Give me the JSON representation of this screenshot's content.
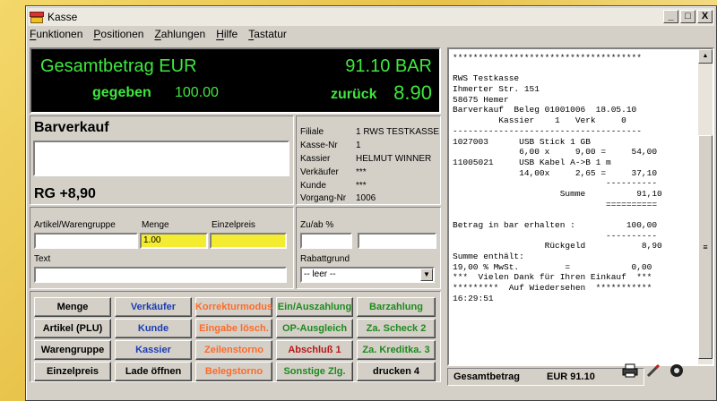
{
  "window": {
    "title": "Kasse",
    "controls": [
      "_",
      "□",
      "X"
    ]
  },
  "menu": [
    "Funktionen",
    "Positionen",
    "Zahlungen",
    "Hilfe",
    "Tastatur"
  ],
  "display": {
    "total_label": "Gesamtbetrag EUR",
    "total_value": "91.10 BAR",
    "given_label": "gegeben",
    "given_value": "100.00",
    "change_label": "zurück",
    "change_value": "8.90"
  },
  "sale": {
    "title": "Barverkauf",
    "rg": "RG +8,90"
  },
  "info": [
    {
      "k": "Filiale",
      "v": "1 RWS TESTKASSE"
    },
    {
      "k": "Kasse-Nr",
      "v": "1"
    },
    {
      "k": "Kassier",
      "v": "HELMUT WINNER"
    },
    {
      "k": "Verkäufer",
      "v": "***"
    },
    {
      "k": "Kunde",
      "v": "***"
    },
    {
      "k": "Vorgang-Nr",
      "v": "1006"
    }
  ],
  "entry": {
    "article_label": "Artikel/Warengruppe",
    "qty_label": "Menge",
    "qty_value": "1.00",
    "price_label": "Einzelpreis",
    "text_label": "Text"
  },
  "rabatt": {
    "zuab_label": "Zu/ab %",
    "grund_label": "Rabattgrund",
    "grund_value": "-- leer --"
  },
  "buttons": [
    {
      "label": "Menge",
      "color": "#000000"
    },
    {
      "label": "Verkäufer",
      "color": "#1a3cb4"
    },
    {
      "label": "Korrekturmodus",
      "color": "#ff6a28"
    },
    {
      "label": "Ein/Auszahlung",
      "color": "#1e8a1e"
    },
    {
      "label": "Barzahlung",
      "color": "#1e8a1e"
    },
    {
      "label": "Artikel (PLU)",
      "color": "#000000"
    },
    {
      "label": "Kunde",
      "color": "#1a3cb4"
    },
    {
      "label": "Eingabe lösch.",
      "color": "#ff6a28"
    },
    {
      "label": "OP-Ausgleich",
      "color": "#1e8a1e"
    },
    {
      "label": "Za. Scheck 2",
      "color": "#1e8a1e"
    },
    {
      "label": "Warengruppe",
      "color": "#000000"
    },
    {
      "label": "Kassier",
      "color": "#1a3cb4"
    },
    {
      "label": "Zeilenstorno",
      "color": "#ff6a28"
    },
    {
      "label": "Abschluß 1",
      "color": "#b81818"
    },
    {
      "label": "Za. Kreditka. 3",
      "color": "#1e8a1e"
    },
    {
      "label": "Einzelpreis",
      "color": "#000000"
    },
    {
      "label": "Lade öffnen",
      "color": "#000000"
    },
    {
      "label": "Belegstorno",
      "color": "#ff6a28"
    },
    {
      "label": "Sonstige Zlg.",
      "color": "#1e8a1e"
    },
    {
      "label": "drucken 4",
      "color": "#000000"
    }
  ],
  "receipt": {
    "lines": [
      "*************************************",
      "",
      "RWS Testkasse",
      "Ihmerter Str. 151",
      "58675 Hemer",
      "Barverkauf  Beleg 01001006  18.05.10",
      "         Kassier    1   Verk     0",
      "-------------------------------------",
      "1027003      USB Stick 1 GB",
      "             6,00 x     9,00 =     54,00",
      "11005021     USB Kabel A->B 1 m",
      "             14,00x     2,65 =     37,10",
      "                              ----------",
      "                     Summe          91,10",
      "                              ==========",
      "",
      "Betrag in bar erhalten :          100,00",
      "                              ----------",
      "                  Rückgeld           8,90",
      "Summe enthält:",
      "19,00 % MwSt.         =            0,00",
      "***  Vielen Dank für Ihren Einkauf  ***",
      "*********  Auf Wiedersehen  ***********",
      "16:29:51"
    ]
  },
  "status": {
    "label": "Gesamtbetrag",
    "value": "EUR 91.10"
  }
}
